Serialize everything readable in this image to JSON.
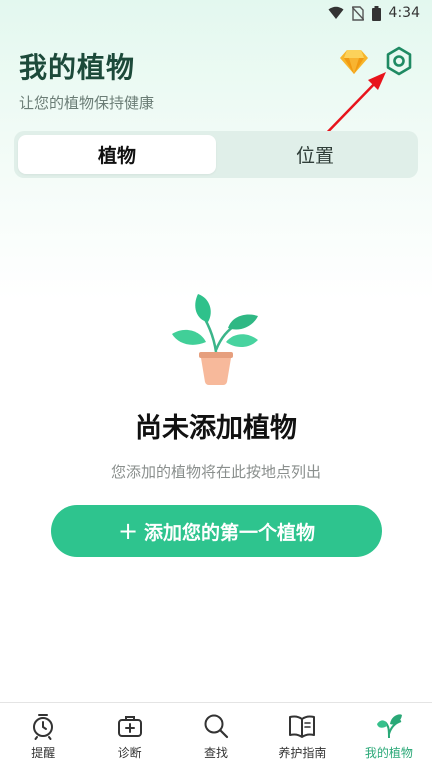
{
  "status_bar": {
    "time": "4:34"
  },
  "header": {
    "title": "我的植物",
    "subtitle": "让您的植物保持健康"
  },
  "tabs": [
    {
      "label": "植物",
      "active": true
    },
    {
      "label": "位置",
      "active": false
    }
  ],
  "empty_state": {
    "title": "尚未添加植物",
    "subtitle": "您添加的植物将在此按地点列出",
    "button_label": "添加您的第一个植物",
    "button_icon": "+"
  },
  "bottom_nav": [
    {
      "label": "提醒",
      "icon": "alarm-clock-icon"
    },
    {
      "label": "诊断",
      "icon": "first-aid-kit-icon"
    },
    {
      "label": "查找",
      "icon": "search-icon"
    },
    {
      "label": "养护指南",
      "icon": "book-icon"
    },
    {
      "label": "我的植物",
      "icon": "plant-leaves-icon",
      "active": true
    }
  ],
  "colors": {
    "accent": "#2ec48e",
    "active_nav": "#2aa877",
    "title": "#1c4a3a",
    "annotation_arrow": "#e8141c"
  }
}
